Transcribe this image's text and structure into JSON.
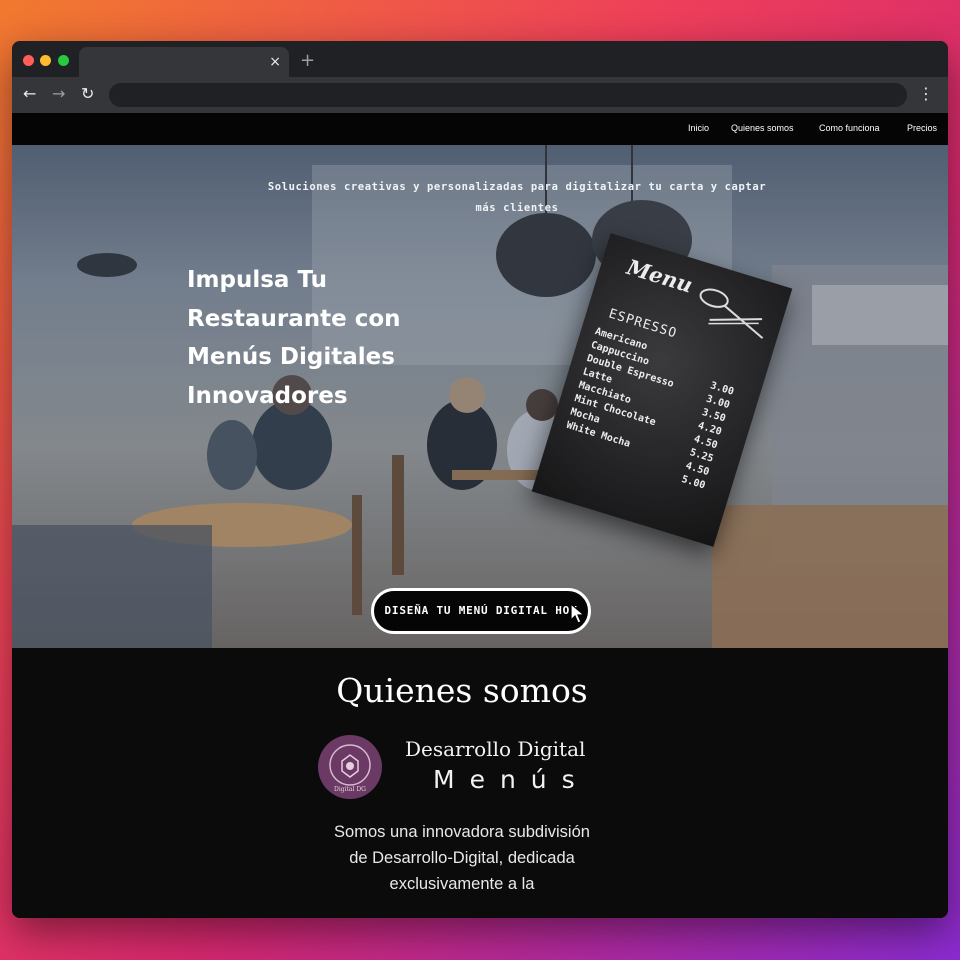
{
  "browser": {
    "tab_close_glyph": "×",
    "new_tab_glyph": "+",
    "back_glyph": "←",
    "forward_glyph": "→",
    "reload_glyph": "↻",
    "menu_glyph": "⋮",
    "address": ""
  },
  "nav": {
    "items": [
      {
        "label": "Inicio"
      },
      {
        "label": "Quienes somos"
      },
      {
        "label": "Como funciona"
      },
      {
        "label": "Precios"
      }
    ]
  },
  "hero": {
    "tagline_line1": "Soluciones creativas y personalizadas para digitalizar tu carta y captar",
    "tagline_line2": "más clientes",
    "headline_lines": [
      "Impulsa Tu",
      "Restaurante con",
      "Menús Digitales",
      "Innovadores"
    ],
    "cta_label": "DISEÑA TU MENÚ DIGITAL HOY",
    "menu_board": {
      "title": "Menu",
      "section": "ESPRESSO",
      "items": [
        "Americano",
        "Cappuccino",
        "Double Espresso",
        "Latte",
        "Macchiato",
        "Mint Chocolate",
        "Mocha",
        "White Mocha"
      ],
      "prices": [
        "3.00",
        "3.00",
        "3.50",
        "4.20",
        "4.50",
        "5.25",
        "4.50",
        "5.00"
      ]
    }
  },
  "about": {
    "title": "Quienes somos",
    "brand_line1": "Desarrollo Digital",
    "brand_line2": "Menús",
    "logo_text": "Digital DG",
    "text_lines": [
      "Somos una innovadora subdivisión",
      "de Desarrollo-Digital, dedicada",
      "exclusivamente a la"
    ]
  },
  "colors": {
    "accent_gradient_start": "#f07a2e",
    "accent_gradient_end": "#8a2bd1",
    "page_bg": "#0b0b0c",
    "logo_purple": "#6b3a64"
  }
}
